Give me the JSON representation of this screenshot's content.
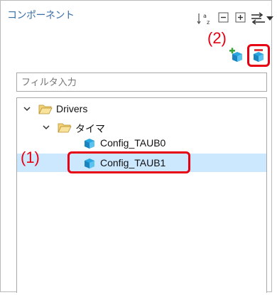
{
  "panel": {
    "title": "コンポーネント",
    "toolbar_icons": [
      "sort-az-icon",
      "collapse-all-icon",
      "expand-all-icon",
      "link-with-editor-icon",
      "view-menu-icon"
    ],
    "action_icons": [
      "add-component-icon",
      "remove-component-icon"
    ]
  },
  "annotations": {
    "label_1": "(1)",
    "label_2": "(2)",
    "highlight_color": "#e60012"
  },
  "filter": {
    "placeholder": "フィルタ入力"
  },
  "tree": {
    "items": [
      {
        "label": "Drivers",
        "type": "folder",
        "expanded": true
      },
      {
        "label": "タイマ",
        "type": "folder",
        "expanded": true
      },
      {
        "label": "Config_TAUB0",
        "type": "component"
      },
      {
        "label": "Config_TAUB1",
        "type": "component",
        "selected": true
      }
    ]
  },
  "colors": {
    "title": "#3a6ea5",
    "selection": "#cce8ff",
    "annotation": "#e60012"
  }
}
